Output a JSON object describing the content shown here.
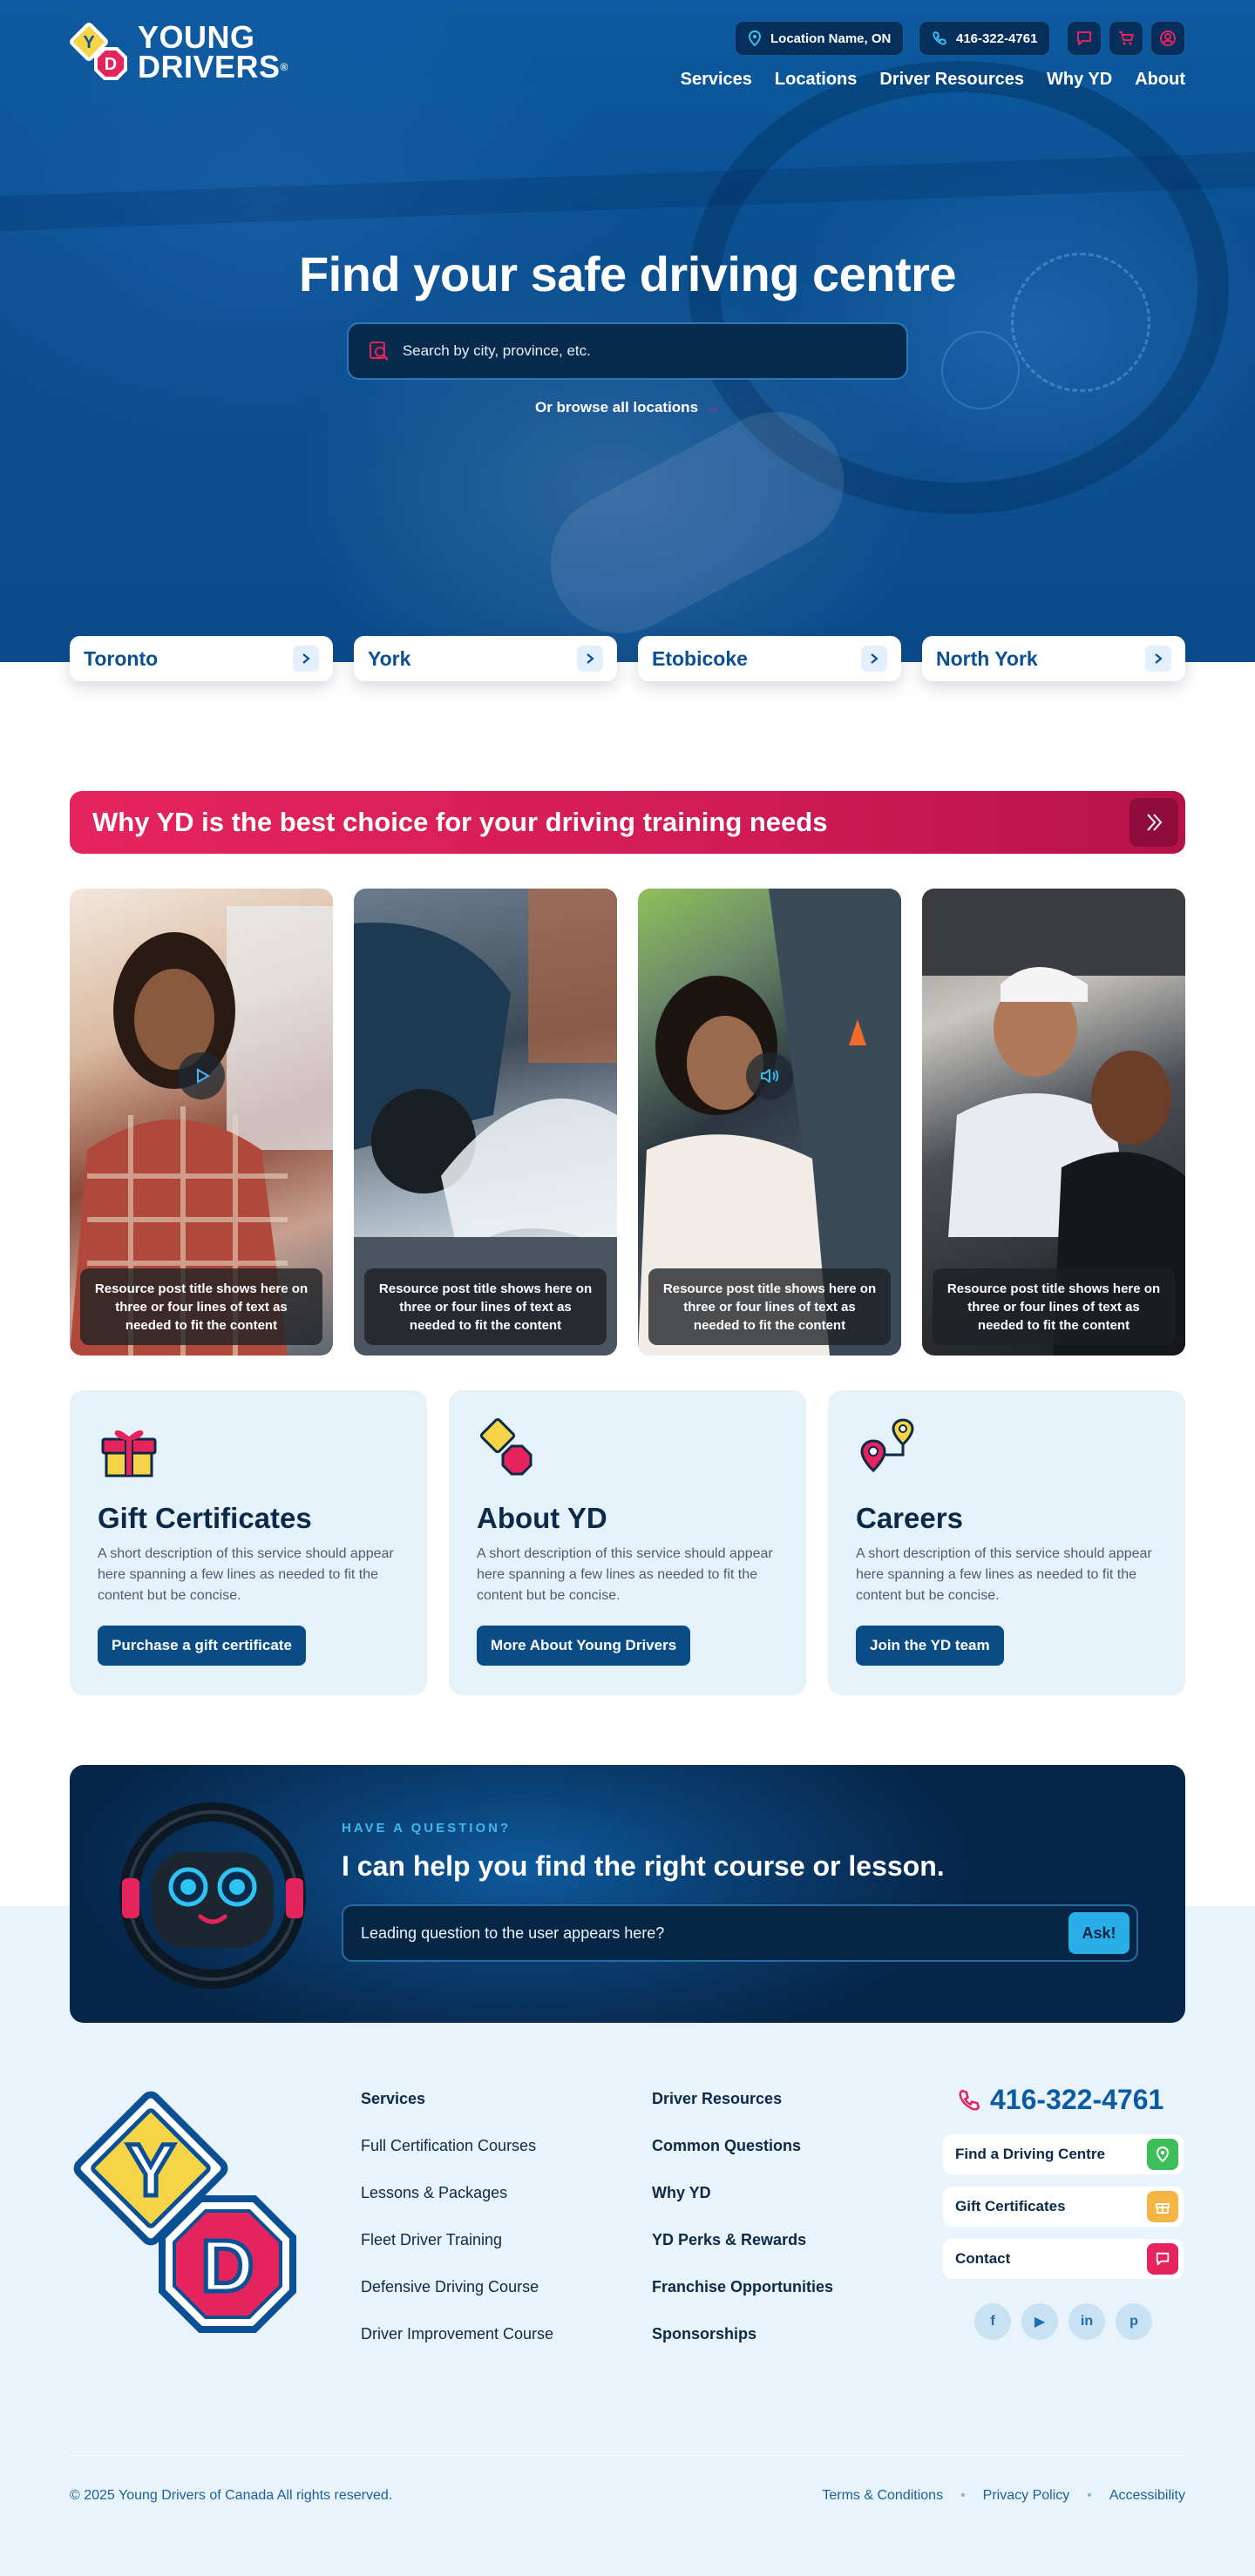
{
  "header": {
    "logo": {
      "line1": "YOUNG",
      "line2": "DRIVERS",
      "mark_top": "Y",
      "mark_bottom": "D"
    },
    "location_pill": "Location Name, ON",
    "phone_pill": "416-322-4761",
    "nav": [
      "Services",
      "Locations",
      "Driver Resources",
      "Why YD",
      "About"
    ]
  },
  "hero": {
    "title": "Find your safe driving centre",
    "search_placeholder": "Search by city, province, etc.",
    "browse_label": "Or browse all locations",
    "cities": [
      "Toronto",
      "York",
      "Etobicoke",
      "North York"
    ]
  },
  "why": {
    "title": "Why YD is the best choice for your driving training needs",
    "resources": [
      {
        "caption": "Resource post title shows here on three or four lines of text as needed to fit the content",
        "media": "play"
      },
      {
        "caption": "Resource post title shows here on three or four lines of text as needed to fit the content",
        "media": ""
      },
      {
        "caption": "Resource post title shows here on three or four lines of text as needed to fit the content",
        "media": "audio"
      },
      {
        "caption": "Resource post title shows here on three or four lines of text as needed to fit the content",
        "media": ""
      }
    ]
  },
  "services": [
    {
      "title": "Gift Certificates",
      "desc": "A short description of this service should appear here spanning a few lines as needed to fit the content but be concise.",
      "button": "Purchase a gift certificate",
      "icon": "gift-icon"
    },
    {
      "title": "About YD",
      "desc": "A short description of this service should appear here spanning a few lines as needed to fit the content but be concise.",
      "button": "More About Young Drivers",
      "icon": "yd-signs-icon"
    },
    {
      "title": "Careers",
      "desc": "A short description of this service should appear here spanning a few lines as needed to fit the content but be concise.",
      "button": "Join the YD team",
      "icon": "route-pins-icon"
    }
  ],
  "assistant": {
    "eyebrow": "HAVE A QUESTION?",
    "title": "I can help you find the right course or lesson.",
    "input_placeholder": "Leading question to the user appears here?",
    "ask_label": "Ask!"
  },
  "footer": {
    "col1": [
      "Services",
      "Full Certification Courses",
      "Lessons & Packages",
      "Fleet Driver Training",
      "Defensive Driving Course",
      "Driver Improvement Course"
    ],
    "col2": [
      "Driver Resources",
      "Common Questions",
      "Why YD",
      "YD Perks & Rewards",
      "Franchise Opportunities",
      "Sponsorships"
    ],
    "phone": "416-322-4761",
    "quick_links": [
      {
        "label": "Find a Driving Centre",
        "color": "#3fbf5a"
      },
      {
        "label": "Gift Certificates",
        "color": "#f5b544"
      },
      {
        "label": "Contact",
        "color": "#e5245e"
      }
    ],
    "social": [
      "f",
      "▶",
      "in",
      "p"
    ],
    "copyright": "© 2025 Young Drivers of Canada All rights reserved.",
    "legal": [
      "Terms & Conditions",
      "Privacy Policy",
      "Accessibility"
    ]
  },
  "colors": {
    "brand_blue": "#0b4f94",
    "accent_pink": "#e5245e",
    "accent_cyan": "#29aee8",
    "yellow": "#f5d547"
  }
}
